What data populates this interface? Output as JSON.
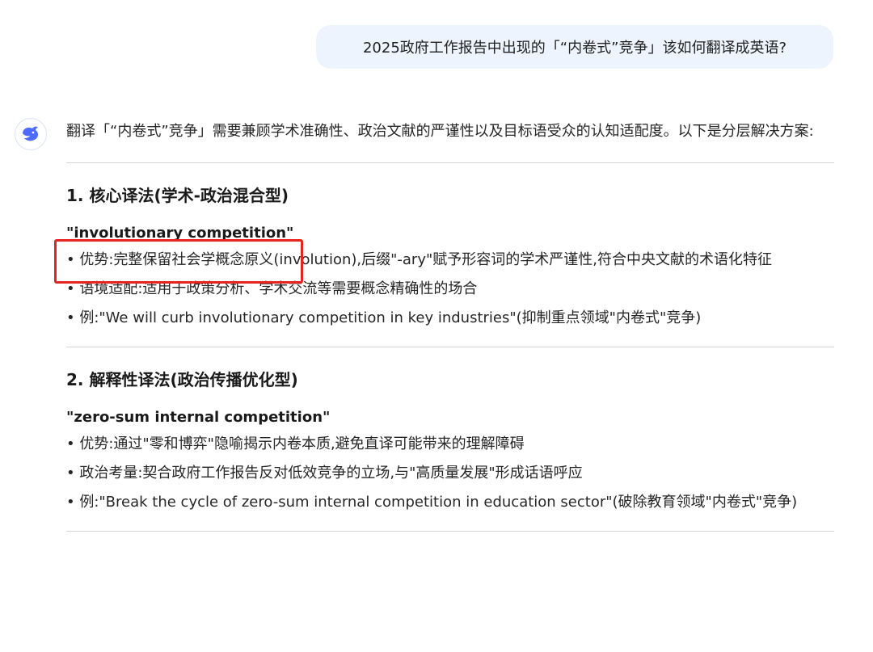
{
  "user_message": "2025政府工作报告中出现的「“内卷式”竞争」该如何翻译成英语?",
  "assistant": {
    "intro": "翻译「“内卷式”竞争」需要兼顾学术准确性、政治文献的严谨性以及目标语受众的认知适配度。以下是分层解决方案:",
    "sections": [
      {
        "heading": "1. 核心译法(学术-政治混合型)",
        "term": "\"involutionary competition\"",
        "bullets": [
          "• 优势:完整保留社会学概念原义(involution),后缀\"-ary\"赋予形容词的学术严谨性,符合中央文献的术语化特征",
          "• 语境适配:适用于政策分析、学术交流等需要概念精确性的场合",
          "• 例:\"We will curb involutionary competition in key industries\"(抑制重点领域\"内卷式\"竞争)"
        ]
      },
      {
        "heading": "2. 解释性译法(政治传播优化型)",
        "term": "\"zero-sum internal competition\"",
        "bullets": [
          "• 优势:通过\"零和博弈\"隐喻揭示内卷本质,避免直译可能带来的理解障碍",
          "• 政治考量:契合政府工作报告反对低效竞争的立场,与\"高质量发展\"形成话语呼应",
          "• 例:\"Break the cycle of zero-sum internal competition in education sector\"(破除教育领域\"内卷式\"竞争)"
        ]
      }
    ]
  },
  "colors": {
    "bubble": "#eef4fd",
    "highlight": "#e8231e",
    "brand": "#4d6bfe"
  },
  "icons": {
    "assistant_avatar": "whale-logo-icon"
  }
}
